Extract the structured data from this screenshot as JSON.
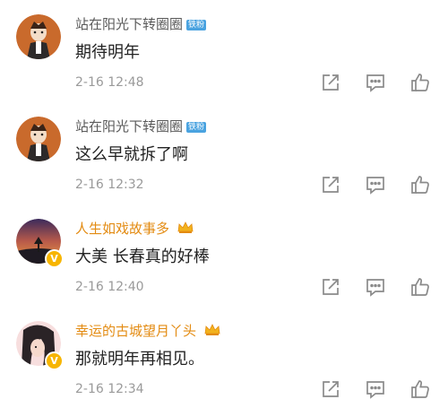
{
  "comments": [
    {
      "username": "站在阳光下转圈圈",
      "badge": "铁粉",
      "text": "期待明年",
      "time": "2-16 12:48"
    },
    {
      "username": "站在阳光下转圈圈",
      "badge": "铁粉",
      "text": "这么早就拆了啊",
      "time": "2-16 12:32"
    },
    {
      "username": "人生如戏故事多",
      "badge": "",
      "text": "大美 长春真的好棒",
      "time": "2-16 12:40"
    },
    {
      "username": "幸运的古城望月丫头",
      "badge": "",
      "text": "那就明年再相见。",
      "time": "2-16 12:34"
    }
  ],
  "icons": {
    "share": "share-icon",
    "comment": "comment-icon",
    "like": "thumbs-up-icon",
    "verified": "verified-v-badge-icon",
    "crown": "crown-icon"
  },
  "colors": {
    "username": "#5a5a5a",
    "username_vip": "#e38b12",
    "badge_bg": "#4aa3e0",
    "text": "#222222",
    "time": "#9a9a9a",
    "icon": "#8a8a8a"
  }
}
